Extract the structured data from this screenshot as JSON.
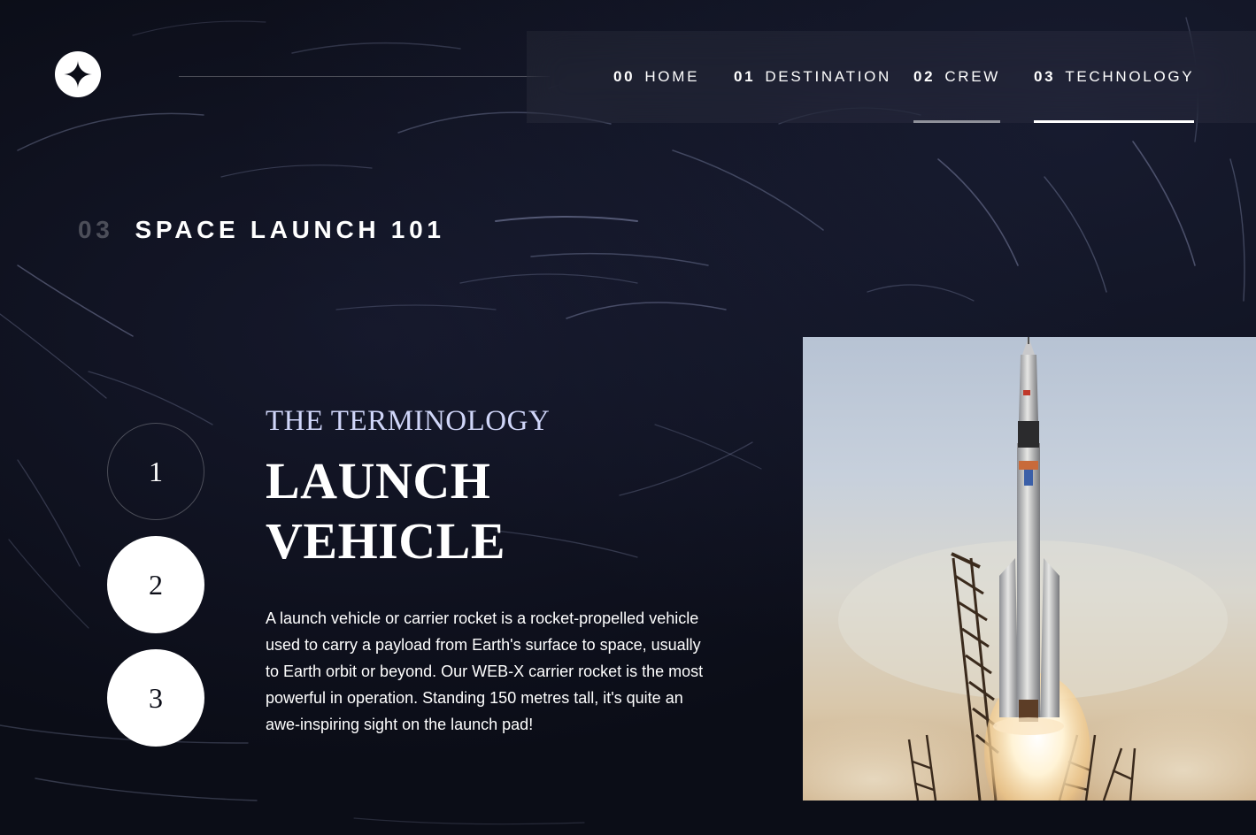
{
  "nav": {
    "items": [
      {
        "num": "00",
        "label": "HOME"
      },
      {
        "num": "01",
        "label": "DESTINATION"
      },
      {
        "num": "02",
        "label": "CREW"
      },
      {
        "num": "03",
        "label": "TECHNOLOGY"
      }
    ],
    "active": "TECHNOLOGY",
    "hovered": "CREW"
  },
  "icons": {
    "logo": "star-logo-icon"
  },
  "page": {
    "num": "03",
    "heading": "SPACE LAUNCH 101"
  },
  "steps": [
    "1",
    "2",
    "3"
  ],
  "content": {
    "subtitle": "THE TERMINOLOGY",
    "title_line1": "LAUNCH",
    "title_line2": "VEHICLE",
    "description": "A launch vehicle or carrier rocket is a rocket-propelled vehicle used to carry a payload from Earth's surface to space, usually to Earth orbit or beyond. Our WEB-X carrier rocket is the most powerful in operation. Standing 150 metres tall, it's quite an awe-inspiring sight on the launch pad!"
  },
  "colors": {
    "background": "#0b0d17",
    "accent_light": "#d0d6f9",
    "white": "#ffffff"
  }
}
